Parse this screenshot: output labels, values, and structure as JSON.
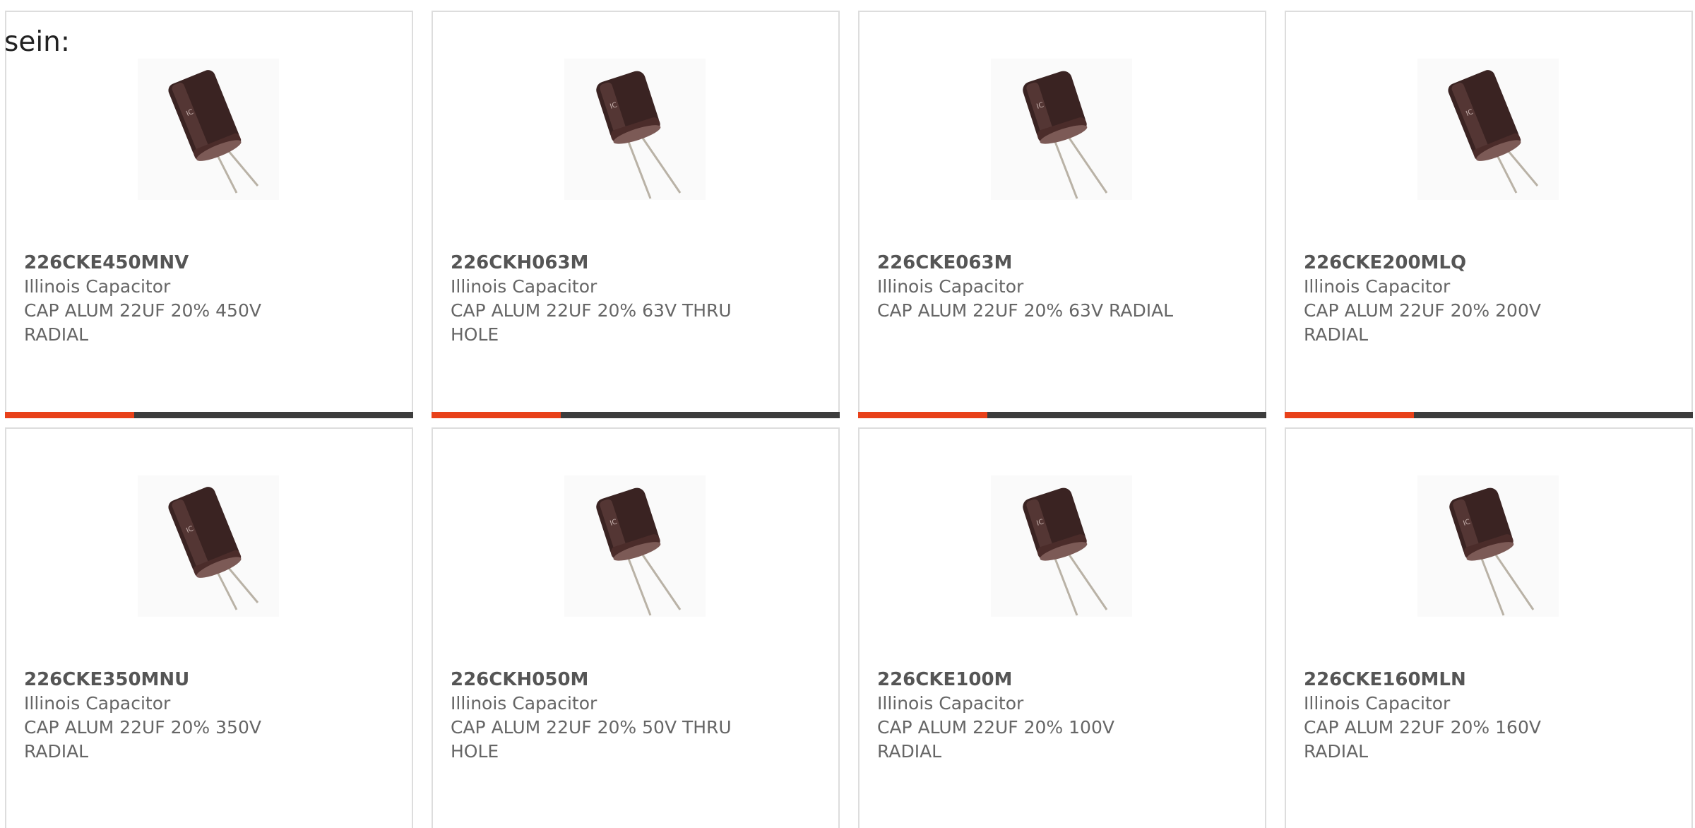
{
  "heading": "sein:",
  "accent_color": "#e8411a",
  "bar_color": "#3d3d3d",
  "image_icon": "capacitor-product-image",
  "products": [
    {
      "part_number": "226CKE450MNV",
      "manufacturer": "Illinois Capacitor",
      "description": "CAP ALUM 22UF 20% 450V RADIAL"
    },
    {
      "part_number": "226CKH063M",
      "manufacturer": "Illinois Capacitor",
      "description": "CAP ALUM 22UF 20% 63V THRU HOLE"
    },
    {
      "part_number": "226CKE063M",
      "manufacturer": "Illinois Capacitor",
      "description": "CAP ALUM 22UF 20% 63V RADIAL"
    },
    {
      "part_number": "226CKE200MLQ",
      "manufacturer": "Illinois Capacitor",
      "description": "CAP ALUM 22UF 20% 200V RADIAL"
    },
    {
      "part_number": "226CKE350MNU",
      "manufacturer": "Illinois Capacitor",
      "description": "CAP ALUM 22UF 20% 350V RADIAL"
    },
    {
      "part_number": "226CKH050M",
      "manufacturer": "Illinois Capacitor",
      "description": "CAP ALUM 22UF 20% 50V THRU HOLE"
    },
    {
      "part_number": "226CKE100M",
      "manufacturer": "Illinois Capacitor",
      "description": "CAP ALUM 22UF 20% 100V RADIAL"
    },
    {
      "part_number": "226CKE160MLN",
      "manufacturer": "Illinois Capacitor",
      "description": "CAP ALUM 22UF 20% 160V RADIAL"
    }
  ]
}
